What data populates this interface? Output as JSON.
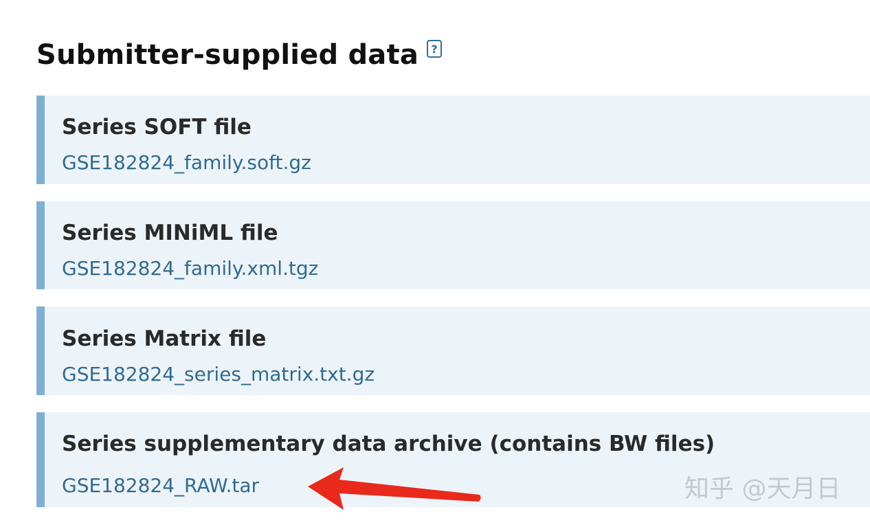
{
  "title": "Submitter-supplied data",
  "help_icon": {
    "glyph": "?",
    "icon": "help-icon"
  },
  "items": [
    {
      "heading": "Series SOFT file",
      "link": "GSE182824_family.soft.gz"
    },
    {
      "heading": "Series MINiML file",
      "link": "GSE182824_family.xml.tgz"
    },
    {
      "heading": "Series Matrix file",
      "link": "GSE182824_series_matrix.txt.gz"
    },
    {
      "heading": "Series supplementary data archive (contains BW files)",
      "link": "GSE182824_RAW.tar"
    }
  ],
  "watermark": "知乎 @天月日",
  "colors": {
    "accent_border": "#7fb0d3",
    "panel_bg": "#edf4f9",
    "link": "#2f6a95",
    "annotation_arrow": "#e8291c"
  }
}
